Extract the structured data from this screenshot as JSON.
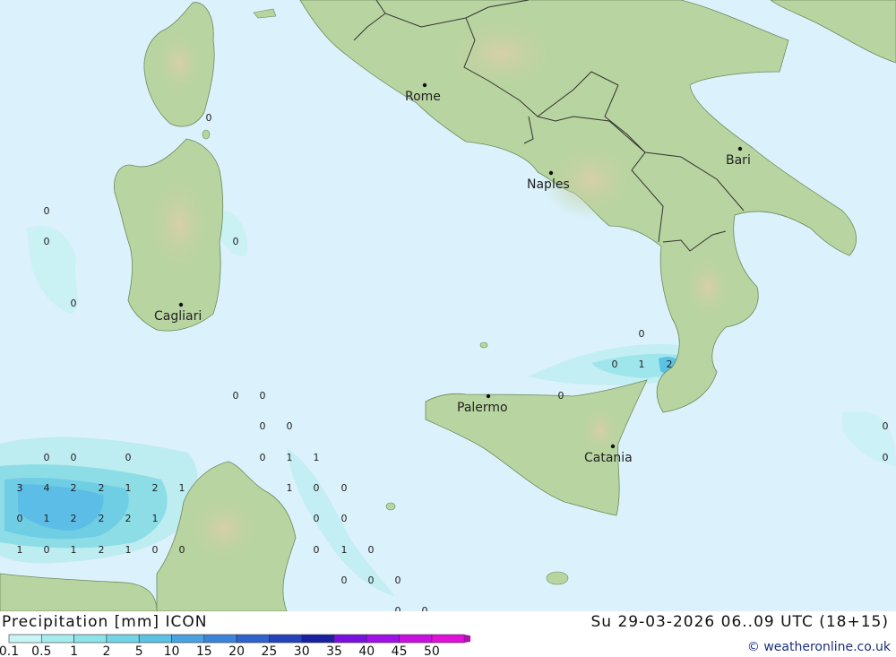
{
  "header": {
    "title": "Precipitation [mm] ICON",
    "datetime": "Su 29-03-2026 06..09 UTC (18+15)",
    "copyright": "© weatheronline.co.uk"
  },
  "cities": [
    {
      "id": "rome",
      "name": "Rome"
    },
    {
      "id": "naples",
      "name": "Naples"
    },
    {
      "id": "bari",
      "name": "Bari"
    },
    {
      "id": "cagliari",
      "name": "Cagliari"
    },
    {
      "id": "palermo",
      "name": "Palermo"
    },
    {
      "id": "catania",
      "name": "Catania"
    }
  ],
  "values": [
    "0",
    "0",
    "0",
    "0",
    "0",
    "0",
    "0",
    "0",
    "0",
    "0",
    "1",
    "0",
    "0",
    "0",
    "0",
    "0",
    "0",
    "0",
    "0",
    "0",
    "0",
    "1",
    "3",
    "4",
    "2",
    "2",
    "1",
    "2",
    "1",
    "1",
    "0",
    "0",
    "0",
    "1",
    "2",
    "2",
    "2",
    "1",
    "0",
    "0",
    "1",
    "0",
    "1",
    "2",
    "1",
    "0",
    "0",
    "0",
    "1",
    "0",
    "0",
    "0",
    "0",
    "0",
    "0",
    "0",
    "1",
    "2",
    "0",
    "0",
    "0",
    "0"
  ],
  "legend": {
    "ticks": [
      "0.1",
      "0.5",
      "1",
      "2",
      "5",
      "10",
      "15",
      "20",
      "25",
      "30",
      "35",
      "40",
      "45",
      "50"
    ],
    "colors": [
      "#c8f5f5",
      "#a5ecee",
      "#8ce3ea",
      "#72d4e6",
      "#5cc2e4",
      "#4aa3e0",
      "#3a84dc",
      "#2f63cc",
      "#2443b8",
      "#1820a0",
      "#7a10e0",
      "#a010e8",
      "#c810e0",
      "#e010d8",
      "#b010b0"
    ]
  },
  "colors": {
    "sea": "#dbf1fb",
    "land": "#b8d4a0",
    "border": "#333333"
  }
}
